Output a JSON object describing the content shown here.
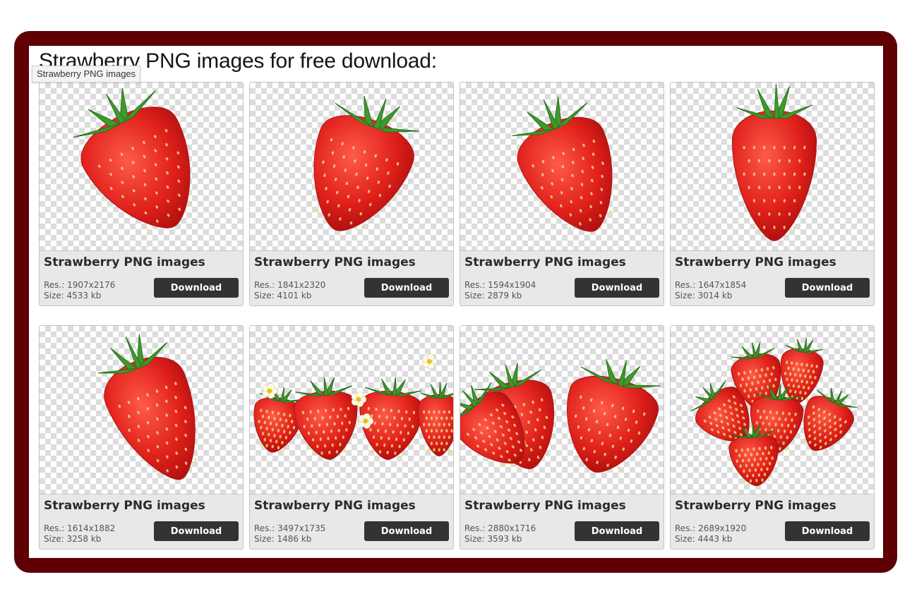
{
  "page": {
    "heading": "Strawberry PNG images for free download:",
    "tooltip": "Strawberry PNG images",
    "download_label": "Download",
    "res_prefix": "Res.: ",
    "size_prefix": "Size: "
  },
  "colors": {
    "frame": "#5e0004",
    "button": "#333333",
    "card_bg": "#e8e8e8"
  },
  "items": [
    {
      "title": "Strawberry PNG images",
      "res": "1907x2176",
      "size": "4533 kb",
      "art": "single-tilted"
    },
    {
      "title": "Strawberry PNG images",
      "res": "1841x2320",
      "size": "4101 kb",
      "art": "single-pale"
    },
    {
      "title": "Strawberry PNG images",
      "res": "1594x1904",
      "size": "2879 kb",
      "art": "single-side"
    },
    {
      "title": "Strawberry PNG images",
      "res": "1647x1854",
      "size": "3014 kb",
      "art": "single-upright"
    },
    {
      "title": "Strawberry PNG images",
      "res": "1614x1882",
      "size": "3258 kb",
      "art": "single-leafy"
    },
    {
      "title": "Strawberry PNG images",
      "res": "3497x1735",
      "size": "1486 kb",
      "art": "border-flowers"
    },
    {
      "title": "Strawberry PNG images",
      "res": "2880x1716",
      "size": "3593 kb",
      "art": "illustrated-pair"
    },
    {
      "title": "Strawberry PNG images",
      "res": "2689x1920",
      "size": "4443 kb",
      "art": "pile"
    }
  ]
}
